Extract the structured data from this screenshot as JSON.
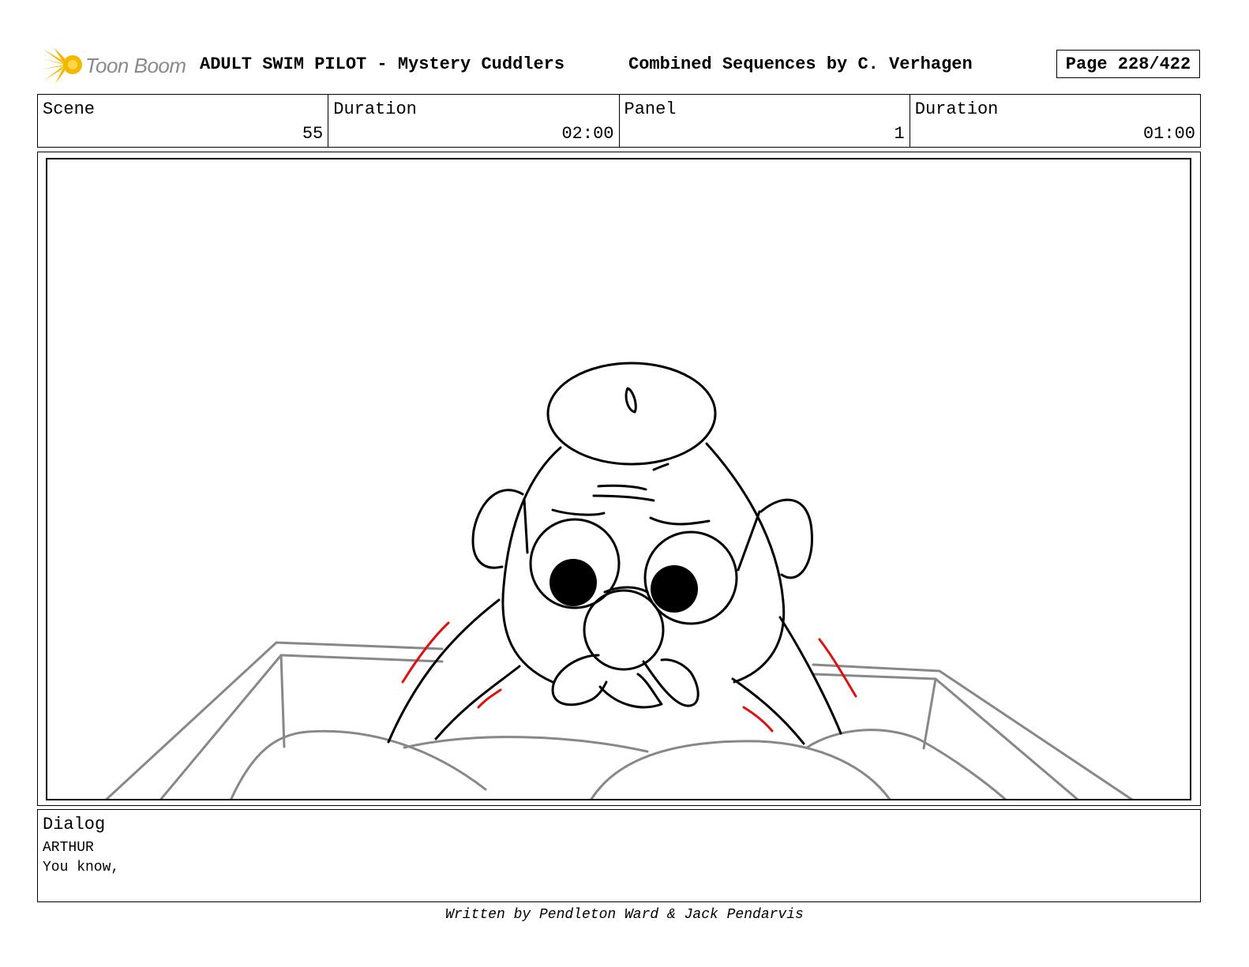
{
  "header": {
    "logo_text": "Toon Boom",
    "logo_icon": "starburst-icon",
    "title": "ADULT SWIM PILOT - Mystery Cuddlers",
    "subtitle": "Combined Sequences by C. Verhagen",
    "page": "Page 228/422"
  },
  "info": {
    "scene_label": "Scene",
    "scene_value": "55",
    "scene_duration_label": "Duration",
    "scene_duration_value": "02:00",
    "panel_label": "Panel",
    "panel_value": "1",
    "panel_duration_label": "Duration",
    "panel_duration_value": "01:00"
  },
  "dialog": {
    "label": "Dialog",
    "character": "ARTHUR",
    "line": "You know,"
  },
  "footer": {
    "credit": "Written by Pendleton Ward & Jack Pendarvis"
  },
  "colors": {
    "logo_yellow": "#f5b800",
    "sketch_line": "#000000",
    "sketch_grey": "#888888",
    "sketch_red": "#e01010"
  }
}
